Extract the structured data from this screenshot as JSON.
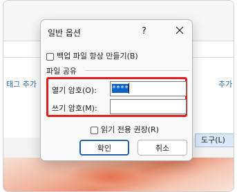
{
  "background": {
    "tag_left": "태그 추가",
    "tag_right": "추가",
    "tools_button": "도구(L)"
  },
  "dialog": {
    "title": "일반 옵션",
    "help_label": "?",
    "backup_label": "백업 파일 항상 만들기(B)",
    "section_label": "파일 공유",
    "open_password_label": "열기 암호(O):",
    "open_password_value": "****",
    "write_password_label": "쓰기 암호(M):",
    "write_password_value": "",
    "readonly_label": "읽기 전용 권장(R)",
    "ok_label": "확인",
    "cancel_label": "취소",
    "colors": {
      "highlight": "#e31b1b",
      "selection": "#0a64c8",
      "default_button_border": "#1f5fae"
    }
  }
}
